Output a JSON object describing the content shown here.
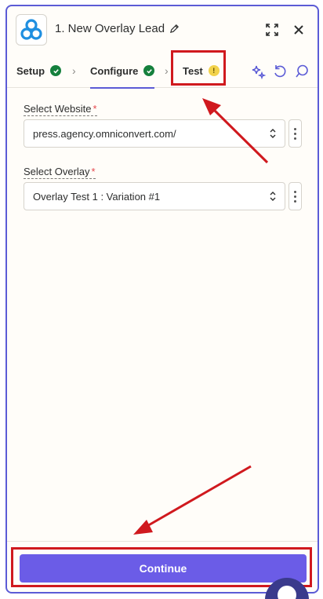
{
  "header": {
    "step_title": "1. New Overlay Lead"
  },
  "tabs": [
    {
      "label": "Setup",
      "status": "complete"
    },
    {
      "label": "Configure",
      "status": "complete"
    },
    {
      "label": "Test",
      "status": "warning"
    }
  ],
  "fields": {
    "website": {
      "label": "Select Website",
      "required_mark": "*",
      "value": "press.agency.omniconvert.com/"
    },
    "overlay": {
      "label": "Select Overlay",
      "required_mark": "*",
      "value": "Overlay Test 1 : Variation #1"
    }
  },
  "footer": {
    "continue_label": "Continue"
  },
  "colors": {
    "accent": "#5b5bd6",
    "button": "#6b5ce7",
    "success": "#15803d",
    "warning": "#f2d24b",
    "annotation": "#d0191e"
  }
}
